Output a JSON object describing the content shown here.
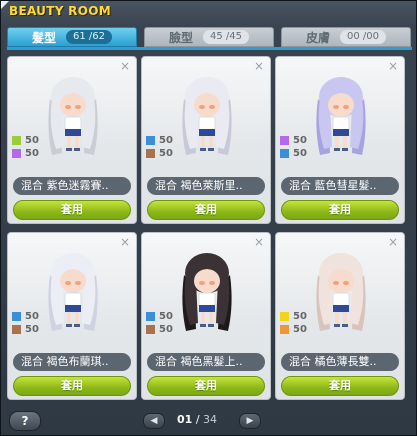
{
  "window": {
    "title": "BEAUTY ROOM"
  },
  "tabs": [
    {
      "label": "髮型",
      "count": "61 /62",
      "active": true
    },
    {
      "label": "臉型",
      "count": "45 /45",
      "active": false
    },
    {
      "label": "皮膚",
      "count": "00 /00",
      "active": false
    }
  ],
  "cards": [
    {
      "hair": "#e6e9ee",
      "hair_dark": "#c9cdd4",
      "colors": [
        {
          "hex": "#9ccc3a",
          "value": "50"
        },
        {
          "hex": "#b36ae8",
          "value": "50"
        }
      ],
      "name": "混合  紫色迷霧賽..",
      "button": "套用"
    },
    {
      "hair": "#e9eaf2",
      "hair_dark": "#c9c8d8",
      "colors": [
        {
          "hex": "#3a8fd8",
          "value": "50"
        },
        {
          "hex": "#a8724e",
          "value": "50"
        }
      ],
      "name": "混合  褐色萊斯里..",
      "button": "套用"
    },
    {
      "hair": "#c9c6ef",
      "hair_dark": "#a7a3e0",
      "colors": [
        {
          "hex": "#b36ae8",
          "value": "50"
        },
        {
          "hex": "#3a8fd8",
          "value": "50"
        }
      ],
      "name": "混合  藍色彗星髮..",
      "button": "套用"
    },
    {
      "hair": "#eceef6",
      "hair_dark": "#cfd2e0",
      "colors": [
        {
          "hex": "#3a8fd8",
          "value": "50"
        },
        {
          "hex": "#a8724e",
          "value": "50"
        }
      ],
      "name": "混合  褐色布蘭琪..",
      "button": "套用"
    },
    {
      "hair": "#3a3234",
      "hair_dark": "#1e1a1b",
      "colors": [
        {
          "hex": "#3a8fd8",
          "value": "50"
        },
        {
          "hex": "#a8724e",
          "value": "50"
        }
      ],
      "name": "混合  褐色黑髮上..",
      "button": "套用"
    },
    {
      "hair": "#f0e2dc",
      "hair_dark": "#d8c4bc",
      "colors": [
        {
          "hex": "#f2d41a",
          "value": "50"
        },
        {
          "hex": "#f0963a",
          "value": "50"
        }
      ],
      "name": "混合  橘色薄長雙..",
      "button": "套用"
    }
  ],
  "footer": {
    "help": "?",
    "page_current": "01",
    "page_sep": "/",
    "page_total": "34",
    "prev": "◀",
    "next": "▶"
  }
}
